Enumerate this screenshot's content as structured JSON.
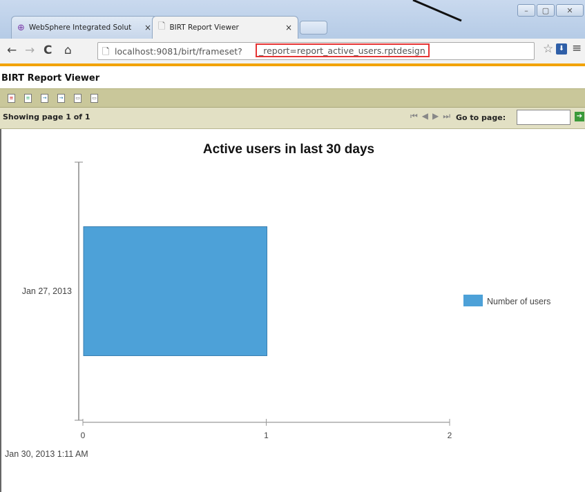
{
  "browser": {
    "tabs": [
      {
        "title": "WebSphere Integrated Solut",
        "close": "×",
        "active": false
      },
      {
        "title": "BIRT Report Viewer",
        "close": "×",
        "active": true
      }
    ],
    "window_controls": [
      "–",
      "▢",
      "✕"
    ],
    "url_host": "localhost:9081/birt/frameset?",
    "url_query": "_report=report_active_users.rptdesign",
    "icons": {
      "back": "back-arrow-icon",
      "forward": "forward-arrow-icon",
      "reload": "reload-icon",
      "home": "home-icon",
      "bookmark": "star-icon",
      "menu": "hamburger-menu-icon"
    }
  },
  "viewer": {
    "title": "BIRT Report Viewer",
    "toolbar_icons": [
      "toc-icon",
      "parameters-icon",
      "export-data-icon",
      "export-report-icon",
      "print-icon",
      "print-server-icon"
    ],
    "showing_text": "Showing page  1  of  1",
    "goto_label": "Go to page:",
    "goto_value": "",
    "accent_color": "#f2a300"
  },
  "chart_data": {
    "type": "bar",
    "orientation": "horizontal",
    "title": "Active users in last 30 days",
    "categories": [
      "Jan 27, 2013"
    ],
    "series": [
      {
        "name": "Number of users",
        "values": [
          1
        ],
        "color": "#4da1d8"
      }
    ],
    "x_ticks": [
      "0",
      "1",
      "2"
    ],
    "xlim": [
      0,
      2
    ],
    "legend_position": "right"
  },
  "report_footer": {
    "timestamp": "Jan 30, 2013 1:11 AM"
  }
}
